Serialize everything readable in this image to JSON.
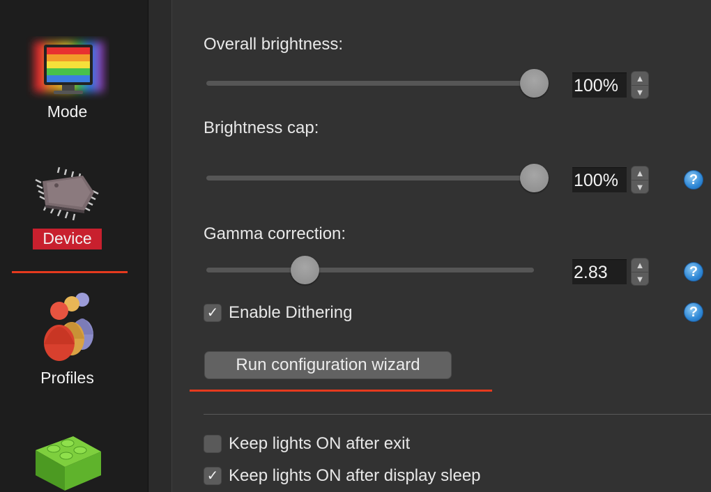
{
  "sidebar": {
    "items": [
      {
        "label": "Mode",
        "icon": "monitor-rainbow-icon"
      },
      {
        "label": "Device",
        "icon": "chip-icon",
        "selected": true
      },
      {
        "label": "Profiles",
        "icon": "people-icon"
      },
      {
        "label": "",
        "icon": "lego-brick-icon"
      }
    ]
  },
  "settings": {
    "overall_brightness": {
      "label": "Overall brightness:",
      "value": "100%",
      "level": 1.0
    },
    "brightness_cap": {
      "label": "Brightness cap:",
      "value": "100%",
      "level": 1.0
    },
    "gamma_correction": {
      "label": "Gamma correction:",
      "value": "2.83",
      "level": 0.3
    },
    "enable_dithering": {
      "label": "Enable Dithering",
      "checked": true
    },
    "wizard_button": "Run configuration wizard",
    "keep_lights_exit": {
      "label": "Keep lights ON after exit",
      "checked": false
    },
    "keep_lights_sleep": {
      "label": "Keep lights ON after display sleep",
      "checked": true
    }
  },
  "help_glyph": "?",
  "stepper_up": "▲",
  "stepper_down": "▼",
  "check_glyph": "✓",
  "colors": {
    "selected": "#c8202e",
    "underline": "#e53a1e",
    "help": "#2f88d6"
  }
}
